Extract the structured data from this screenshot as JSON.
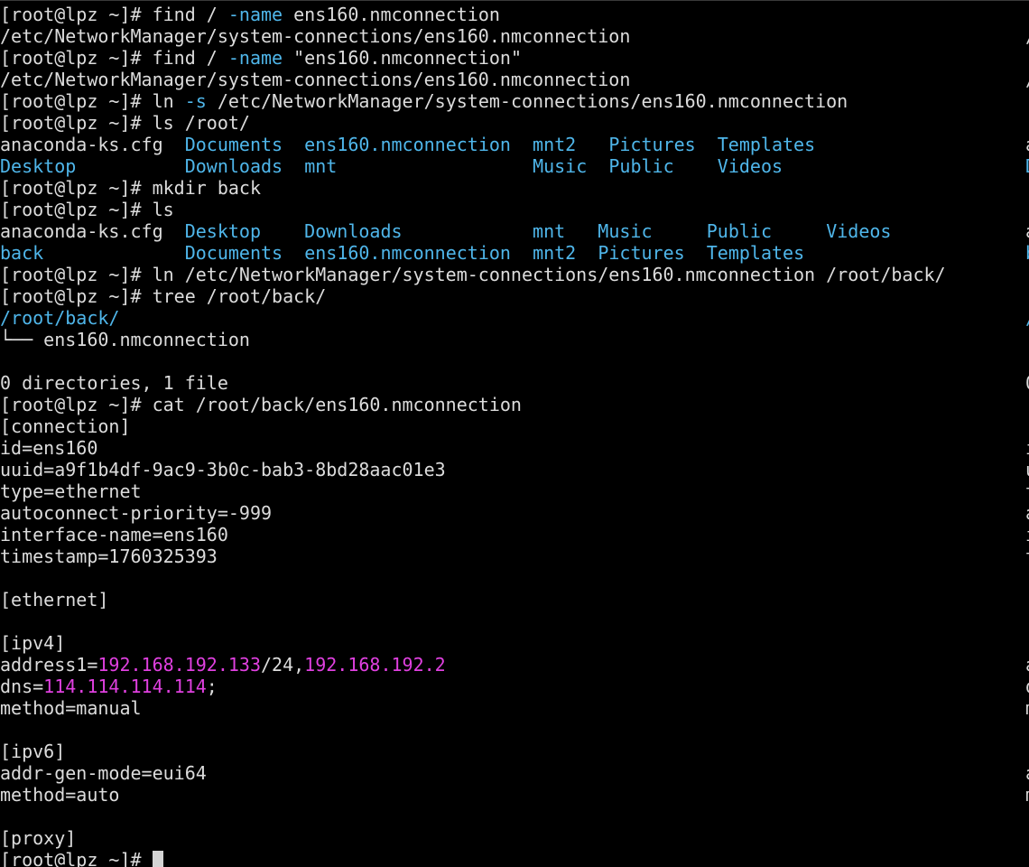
{
  "colors": {
    "background": "#000000",
    "text": "#dcdcdc",
    "directory": "#4fb6ea",
    "option": "#4fb6ea",
    "ip_address": "#e040e0",
    "cursor": "#d4d4d4"
  },
  "lines": [
    [
      {
        "t": "[root@lpz ~]# find / ",
        "c": "def"
      },
      {
        "t": "-name",
        "c": "opt"
      },
      {
        "t": " ens160.nmconnection",
        "c": "def"
      }
    ],
    [
      {
        "t": "/etc/NetworkManager/system-connections/ens160.nmconnection",
        "c": "def"
      }
    ],
    [
      {
        "t": "[root@lpz ~]# find / ",
        "c": "def"
      },
      {
        "t": "-name",
        "c": "opt"
      },
      {
        "t": " \"ens160.nmconnection\"",
        "c": "def"
      }
    ],
    [
      {
        "t": "/etc/NetworkManager/system-connections/ens160.nmconnection",
        "c": "def"
      }
    ],
    [
      {
        "t": "[root@lpz ~]# ln ",
        "c": "def"
      },
      {
        "t": "-s",
        "c": "opt"
      },
      {
        "t": " /etc/NetworkManager/system-connections/ens160.nmconnection",
        "c": "def"
      }
    ],
    [
      {
        "t": "[root@lpz ~]# ls /root/",
        "c": "def"
      }
    ],
    [
      {
        "t": "anaconda-ks.cfg  ",
        "c": "def"
      },
      {
        "t": "Documents",
        "c": "dir"
      },
      {
        "t": "  ",
        "c": "def"
      },
      {
        "t": "ens160.nmconnection",
        "c": "dir"
      },
      {
        "t": "  ",
        "c": "def"
      },
      {
        "t": "mnt2",
        "c": "dir"
      },
      {
        "t": "   ",
        "c": "def"
      },
      {
        "t": "Pictures",
        "c": "dir"
      },
      {
        "t": "  ",
        "c": "def"
      },
      {
        "t": "Templates",
        "c": "dir"
      }
    ],
    [
      {
        "t": "Desktop",
        "c": "dir"
      },
      {
        "t": "          ",
        "c": "def"
      },
      {
        "t": "Downloads",
        "c": "dir"
      },
      {
        "t": "  ",
        "c": "def"
      },
      {
        "t": "mnt",
        "c": "dir"
      },
      {
        "t": "                  ",
        "c": "def"
      },
      {
        "t": "Music",
        "c": "dir"
      },
      {
        "t": "  ",
        "c": "def"
      },
      {
        "t": "Public",
        "c": "dir"
      },
      {
        "t": "    ",
        "c": "def"
      },
      {
        "t": "Videos",
        "c": "dir"
      }
    ],
    [
      {
        "t": "[root@lpz ~]# mkdir back",
        "c": "def"
      }
    ],
    [
      {
        "t": "[root@lpz ~]# ls",
        "c": "def"
      }
    ],
    [
      {
        "t": "anaconda-ks.cfg  ",
        "c": "def"
      },
      {
        "t": "Desktop",
        "c": "dir"
      },
      {
        "t": "    ",
        "c": "def"
      },
      {
        "t": "Downloads",
        "c": "dir"
      },
      {
        "t": "            ",
        "c": "def"
      },
      {
        "t": "mnt",
        "c": "dir"
      },
      {
        "t": "   ",
        "c": "def"
      },
      {
        "t": "Music",
        "c": "dir"
      },
      {
        "t": "     ",
        "c": "def"
      },
      {
        "t": "Public",
        "c": "dir"
      },
      {
        "t": "     ",
        "c": "def"
      },
      {
        "t": "Videos",
        "c": "dir"
      }
    ],
    [
      {
        "t": "back",
        "c": "dir"
      },
      {
        "t": "             ",
        "c": "def"
      },
      {
        "t": "Documents",
        "c": "dir"
      },
      {
        "t": "  ",
        "c": "def"
      },
      {
        "t": "ens160.nmconnection",
        "c": "dir"
      },
      {
        "t": "  ",
        "c": "def"
      },
      {
        "t": "mnt2",
        "c": "dir"
      },
      {
        "t": "  ",
        "c": "def"
      },
      {
        "t": "Pictures",
        "c": "dir"
      },
      {
        "t": "  ",
        "c": "def"
      },
      {
        "t": "Templates",
        "c": "dir"
      }
    ],
    [
      {
        "t": "[root@lpz ~]# ln /etc/NetworkManager/system-connections/ens160.nmconnection /root/back/",
        "c": "def"
      }
    ],
    [
      {
        "t": "[root@lpz ~]# tree /root/back/",
        "c": "def"
      }
    ],
    [
      {
        "t": "/root/back/",
        "c": "dir"
      }
    ],
    [
      {
        "t": "└── ens160.nmconnection",
        "c": "def"
      }
    ],
    [
      {
        "t": "",
        "c": "def"
      }
    ],
    [
      {
        "t": "0 directories, 1 file",
        "c": "def"
      }
    ],
    [
      {
        "t": "[root@lpz ~]# cat /root/back/ens160.nmconnection",
        "c": "def"
      }
    ],
    [
      {
        "t": "[connection]",
        "c": "def"
      }
    ],
    [
      {
        "t": "id=ens160",
        "c": "def"
      }
    ],
    [
      {
        "t": "uuid=a9f1b4df-9ac9-3b0c-bab3-8bd28aac01e3",
        "c": "def"
      }
    ],
    [
      {
        "t": "type=ethernet",
        "c": "def"
      }
    ],
    [
      {
        "t": "autoconnect-priority=-999",
        "c": "def"
      }
    ],
    [
      {
        "t": "interface-name=ens160",
        "c": "def"
      }
    ],
    [
      {
        "t": "timestamp=1760325393",
        "c": "def"
      }
    ],
    [
      {
        "t": "",
        "c": "def"
      }
    ],
    [
      {
        "t": "[ethernet]",
        "c": "def"
      }
    ],
    [
      {
        "t": "",
        "c": "def"
      }
    ],
    [
      {
        "t": "[ipv4]",
        "c": "def"
      }
    ],
    [
      {
        "t": "address1=",
        "c": "def"
      },
      {
        "t": "192.168.192.133",
        "c": "ip"
      },
      {
        "t": "/24,",
        "c": "def"
      },
      {
        "t": "192.168.192.2",
        "c": "ip"
      }
    ],
    [
      {
        "t": "dns=",
        "c": "def"
      },
      {
        "t": "114.114.114.114",
        "c": "ip"
      },
      {
        "t": ";",
        "c": "def"
      }
    ],
    [
      {
        "t": "method=manual",
        "c": "def"
      }
    ],
    [
      {
        "t": "",
        "c": "def"
      }
    ],
    [
      {
        "t": "[ipv6]",
        "c": "def"
      }
    ],
    [
      {
        "t": "addr-gen-mode=eui64",
        "c": "def"
      }
    ],
    [
      {
        "t": "method=auto",
        "c": "def"
      }
    ],
    [
      {
        "t": "",
        "c": "def"
      }
    ],
    [
      {
        "t": "[proxy]",
        "c": "def"
      }
    ],
    [
      {
        "t": "[root@lpz ~]# ",
        "c": "def"
      }
    ]
  ],
  "right_edge_chars": [
    {
      "t": "",
      "c": "def"
    },
    {
      "t": "/",
      "c": "def"
    },
    {
      "t": "",
      "c": "def"
    },
    {
      "t": "/",
      "c": "def"
    },
    {
      "t": "",
      "c": "def"
    },
    {
      "t": "",
      "c": "def"
    },
    {
      "t": "a",
      "c": "def"
    },
    {
      "t": "D",
      "c": "dir"
    },
    {
      "t": "",
      "c": "def"
    },
    {
      "t": "",
      "c": "def"
    },
    {
      "t": "a",
      "c": "def"
    },
    {
      "t": "b",
      "c": "dir"
    },
    {
      "t": "",
      "c": "def"
    },
    {
      "t": "",
      "c": "def"
    },
    {
      "t": "/",
      "c": "dir"
    },
    {
      "t": "",
      "c": "def"
    },
    {
      "t": "",
      "c": "def"
    },
    {
      "t": "0",
      "c": "def"
    },
    {
      "t": "",
      "c": "def"
    },
    {
      "t": "",
      "c": "def"
    },
    {
      "t": "i",
      "c": "def"
    },
    {
      "t": "u",
      "c": "def"
    },
    {
      "t": "t",
      "c": "def"
    },
    {
      "t": "a",
      "c": "def"
    },
    {
      "t": "i",
      "c": "def"
    },
    {
      "t": "t",
      "c": "def"
    },
    {
      "t": "",
      "c": "def"
    },
    {
      "t": "",
      "c": "def"
    },
    {
      "t": "",
      "c": "def"
    },
    {
      "t": "",
      "c": "def"
    },
    {
      "t": "a",
      "c": "def"
    },
    {
      "t": "d",
      "c": "def"
    },
    {
      "t": "m",
      "c": "def"
    },
    {
      "t": "",
      "c": "def"
    },
    {
      "t": "",
      "c": "def"
    },
    {
      "t": "a",
      "c": "def"
    },
    {
      "t": "m",
      "c": "def"
    },
    {
      "t": "",
      "c": "def"
    },
    {
      "t": "",
      "c": "def"
    },
    {
      "t": "",
      "c": "def"
    }
  ]
}
